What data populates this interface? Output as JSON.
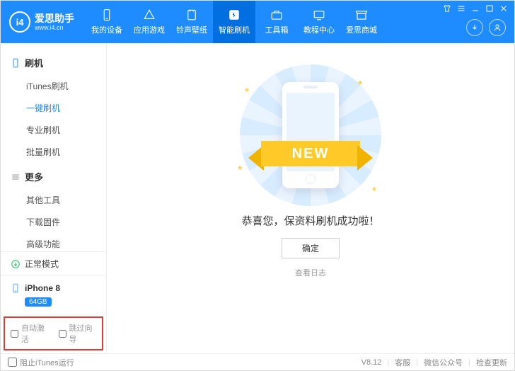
{
  "logo": {
    "badge": "i4",
    "title": "爱思助手",
    "url": "www.i4.cn"
  },
  "nav": [
    {
      "label": "我的设备"
    },
    {
      "label": "应用游戏"
    },
    {
      "label": "铃声壁纸"
    },
    {
      "label": "智能刷机"
    },
    {
      "label": "工具箱"
    },
    {
      "label": "教程中心"
    },
    {
      "label": "爱思商城"
    }
  ],
  "sidebar": {
    "group1": {
      "title": "刷机",
      "items": [
        "iTunes刷机",
        "一键刷机",
        "专业刷机",
        "批量刷机"
      ]
    },
    "group2": {
      "title": "更多",
      "items": [
        "其他工具",
        "下载固件",
        "高级功能"
      ]
    },
    "status": "正常模式",
    "device_name": "iPhone 8",
    "storage": "64GB",
    "check_auto_activate": "自动激活",
    "check_skip_guide": "跳过向导"
  },
  "main": {
    "ribbon": "NEW",
    "success": "恭喜您，保资料刷机成功啦！",
    "confirm": "确定",
    "view_log": "查看日志"
  },
  "footer": {
    "block_itunes": "阻止iTunes运行",
    "version": "V8.12",
    "support": "客服",
    "wechat": "微信公众号",
    "check_update": "检查更新"
  }
}
